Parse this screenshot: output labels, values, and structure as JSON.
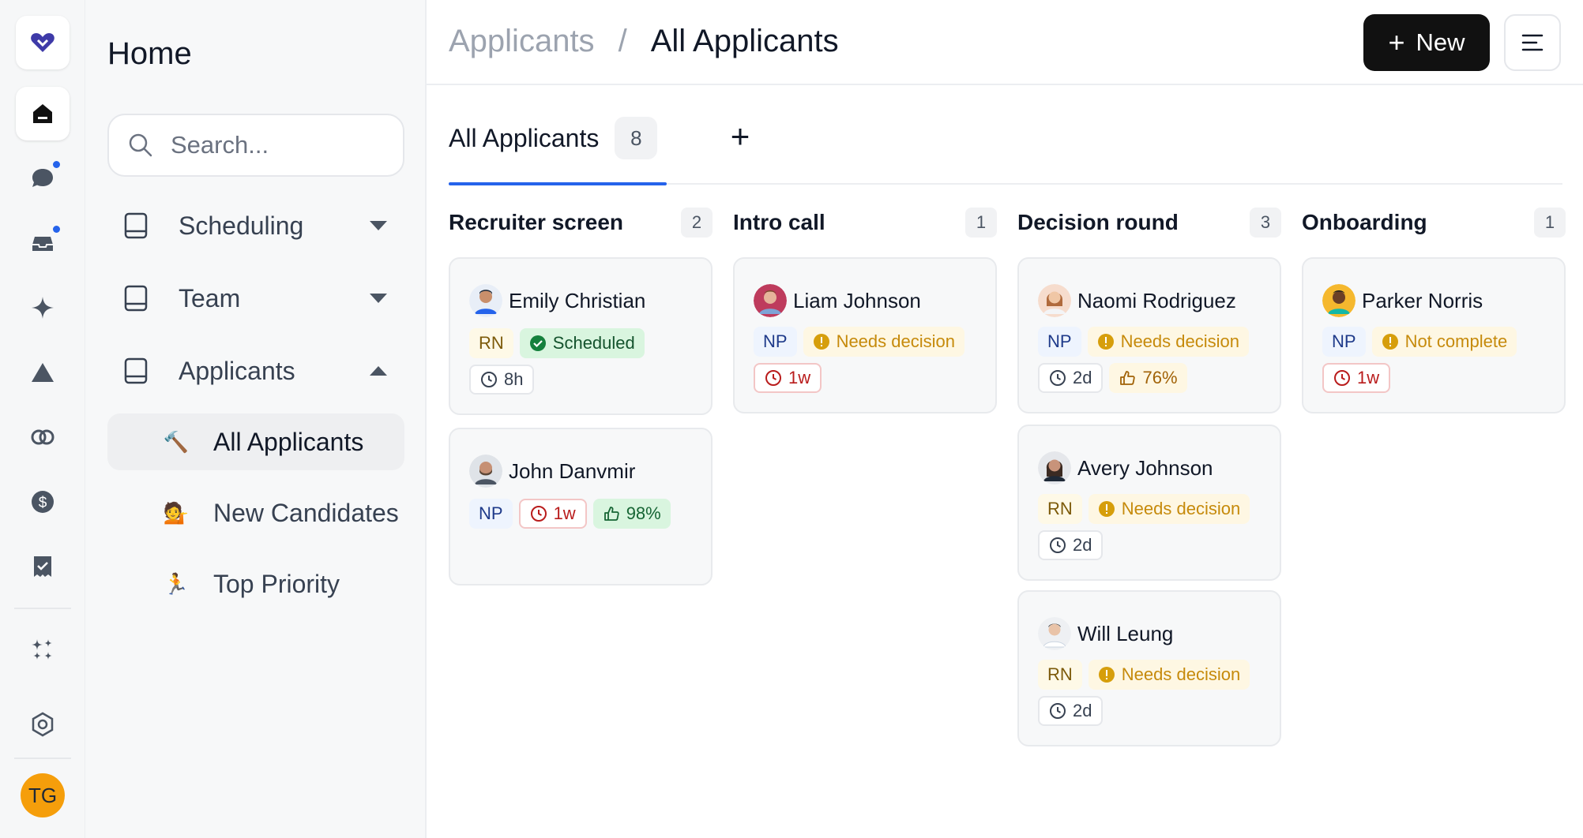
{
  "nav": {
    "title": "Home",
    "search_placeholder": "Search...",
    "sections": [
      {
        "label": "Scheduling"
      },
      {
        "label": "Team"
      },
      {
        "label": "Applicants"
      }
    ],
    "subitems": [
      {
        "emoji": "🔨",
        "label": "All Applicants"
      },
      {
        "emoji": "💁",
        "label": "New Candidates"
      },
      {
        "emoji": "🏃",
        "label": "Top Priority"
      }
    ]
  },
  "user": {
    "initials": "TG"
  },
  "header": {
    "crumb_parent": "Applicants",
    "crumb_sep": "/",
    "crumb_current": "All Applicants",
    "new_label": "New",
    "new_icon": "+"
  },
  "tabs": {
    "active_label": "All Applicants",
    "active_count": "8",
    "add_icon": "+"
  },
  "colors": {
    "accent": "#2563eb",
    "primary_button": "#111111"
  },
  "columns": [
    {
      "title": "Recruiter screen",
      "count": "2",
      "cards": [
        {
          "name": "Emily Christian",
          "role": "RN",
          "status": "Scheduled",
          "time": "8h"
        },
        {
          "name": "John Danvmir",
          "role": "NP",
          "time": "1w",
          "score": "98%"
        }
      ]
    },
    {
      "title": "Intro call",
      "count": "1",
      "cards": [
        {
          "name": "Liam Johnson",
          "role": "NP",
          "status": "Needs decision",
          "time": "1w"
        }
      ]
    },
    {
      "title": "Decision round",
      "count": "3",
      "cards": [
        {
          "name": "Naomi Rodriguez",
          "role": "NP",
          "status": "Needs decision",
          "time": "2d",
          "score": "76%"
        },
        {
          "name": "Avery Johnson",
          "role": "RN",
          "status": "Needs decision",
          "time": "2d"
        },
        {
          "name": "Will Leung",
          "role": "RN",
          "status": "Needs decision",
          "time": "2d"
        }
      ]
    },
    {
      "title": "Onboarding",
      "count": "1",
      "cards": [
        {
          "name": "Parker Norris",
          "role": "NP",
          "status": "Not complete",
          "time": "1w"
        }
      ]
    }
  ]
}
